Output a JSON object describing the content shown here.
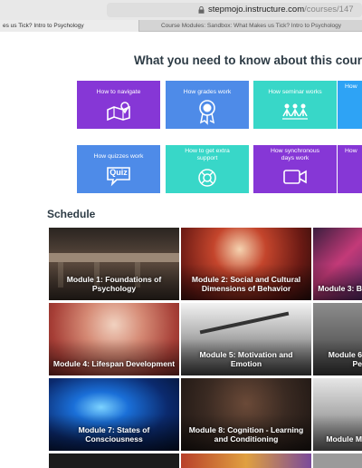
{
  "browser": {
    "url_host": "stepmojo.instructure.com",
    "url_path": "/courses/147",
    "tabs": [
      {
        "label": "es us Tick? Intro to Psychology"
      },
      {
        "label": "Course Modules: Sandbox: What Makes us Tick? Intro to Psychology"
      }
    ]
  },
  "main": {
    "title": "What you need to know about this course",
    "tiles": [
      {
        "label": "How to navigate",
        "color": "#8637d6",
        "icon": "map-pin-icon"
      },
      {
        "label": "How grades work",
        "color": "#4e8be8",
        "icon": "award-ribbon-icon"
      },
      {
        "label": "How seminar works",
        "color": "#38d7c8",
        "icon": "group-people-icon"
      },
      {
        "label": "How",
        "color": "#2ea3f5",
        "icon": ""
      },
      {
        "label": "How quizzes work",
        "color": "#4e8be8",
        "icon": "quiz-bubble-icon"
      },
      {
        "label": "How to get extra support",
        "color": "#38d7c8",
        "icon": "lifebuoy-icon"
      },
      {
        "label": "How synchronous days work",
        "color": "#8637d6",
        "icon": "video-camera-icon"
      },
      {
        "label": "How",
        "color": "#8637d6",
        "icon": ""
      }
    ],
    "quiz_icon_text": "Quiz",
    "schedule_heading": "Schedule",
    "modules": [
      {
        "label": "Module 1: Foundations of Psychology"
      },
      {
        "label": "Module 2: Social and Cultural Dimensions of Behavior"
      },
      {
        "label": "Module 3: B"
      },
      {
        "label": "Module 4: Lifespan Development"
      },
      {
        "label": "Module 5: Motivation and Emotion"
      },
      {
        "label": "Module 6 Pe"
      },
      {
        "label": "Module 7: States of Consciousness"
      },
      {
        "label": "Module 8: Cognition - Learning and Conditioning"
      },
      {
        "label": "Module M"
      }
    ]
  }
}
